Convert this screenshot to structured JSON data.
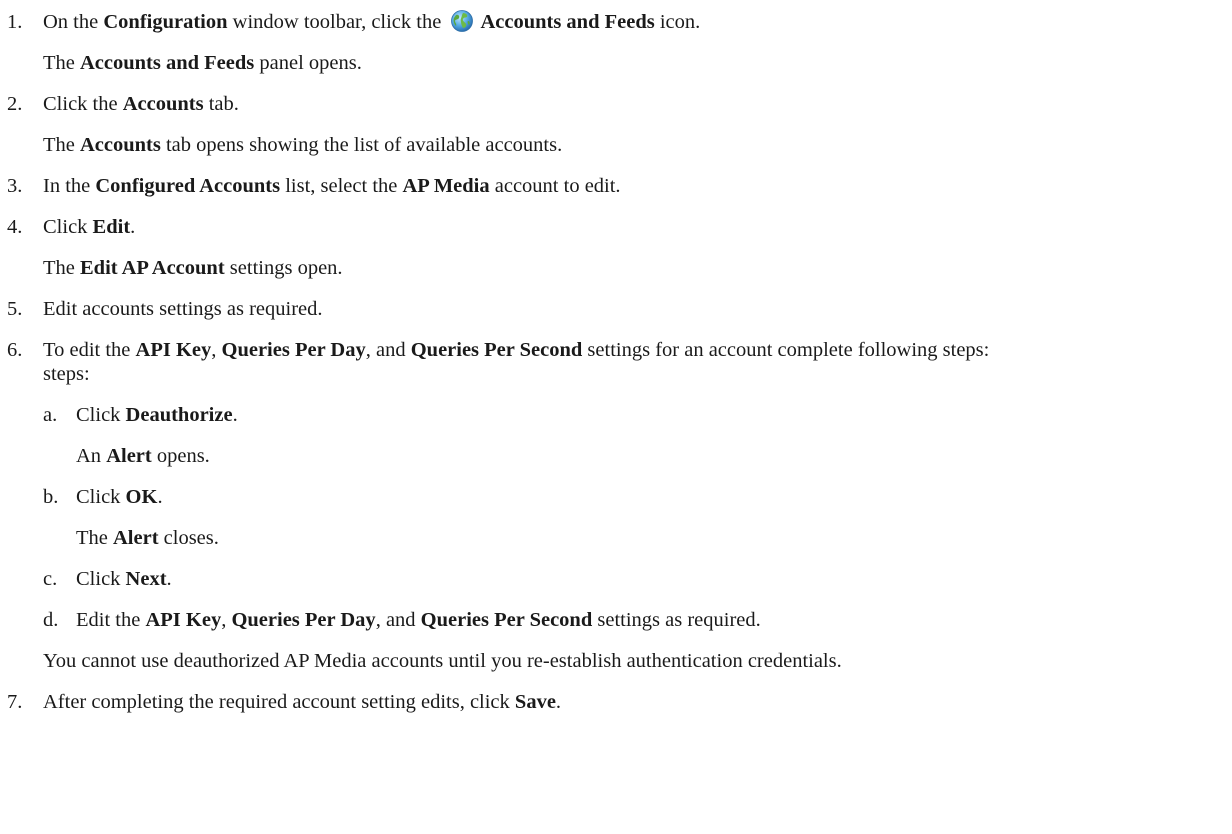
{
  "steps": [
    {
      "num": "1.",
      "parts": [
        {
          "t": "On the "
        },
        {
          "b": "Configuration"
        },
        {
          "t": " window toolbar, click the "
        },
        {
          "icon": "globe-icon"
        },
        {
          "b": "Accounts and Feeds"
        },
        {
          "t": " icon."
        }
      ],
      "result": [
        {
          "t": "The "
        },
        {
          "b": "Accounts and Feeds"
        },
        {
          "t": " panel opens."
        }
      ]
    },
    {
      "num": "2.",
      "parts": [
        {
          "t": "Click the "
        },
        {
          "b": "Accounts"
        },
        {
          "t": " tab."
        }
      ],
      "result": [
        {
          "t": "The "
        },
        {
          "b": "Accounts"
        },
        {
          "t": " tab opens showing the list of available accounts."
        }
      ]
    },
    {
      "num": "3.",
      "parts": [
        {
          "t": "In the "
        },
        {
          "b": "Configured Accounts"
        },
        {
          "t": " list, select the "
        },
        {
          "b": "AP Media"
        },
        {
          "t": " account to edit."
        }
      ]
    },
    {
      "num": "4.",
      "parts": [
        {
          "t": "Click "
        },
        {
          "b": "Edit"
        },
        {
          "t": "."
        }
      ],
      "result": [
        {
          "t": "The "
        },
        {
          "b": "Edit AP Account"
        },
        {
          "t": " settings open."
        }
      ]
    },
    {
      "num": "5.",
      "parts": [
        {
          "t": "Edit accounts settings as required."
        }
      ]
    },
    {
      "num": "6.",
      "parts": [
        {
          "t": "To edit the "
        },
        {
          "b": "API Key"
        },
        {
          "t": ", "
        },
        {
          "b": "Queries Per Day"
        },
        {
          "t": ", and "
        },
        {
          "b": "Queries Per Second"
        },
        {
          "t": " settings for an account complete following steps:"
        }
      ],
      "substeps": [
        {
          "letter": "a.",
          "parts": [
            {
              "t": "Click "
            },
            {
              "b": "Deauthorize"
            },
            {
              "t": "."
            }
          ],
          "result": [
            {
              "t": "An "
            },
            {
              "b": "Alert"
            },
            {
              "t": " opens."
            }
          ]
        },
        {
          "letter": "b.",
          "parts": [
            {
              "t": "Click "
            },
            {
              "b": "OK"
            },
            {
              "t": "."
            }
          ],
          "result": [
            {
              "t": "The "
            },
            {
              "b": "Alert"
            },
            {
              "t": " closes."
            }
          ]
        },
        {
          "letter": "c.",
          "parts": [
            {
              "t": "Click "
            },
            {
              "b": "Next"
            },
            {
              "t": "."
            }
          ]
        },
        {
          "letter": "d.",
          "parts": [
            {
              "t": "Edit the "
            },
            {
              "b": "API Key"
            },
            {
              "t": ", "
            },
            {
              "b": "Queries Per Day"
            },
            {
              "t": ", and "
            },
            {
              "b": "Queries Per Second"
            },
            {
              "t": " settings as required."
            }
          ]
        }
      ],
      "note": "You cannot use deauthorized AP Media accounts until you re-establish authentication credentials."
    },
    {
      "num": "7.",
      "parts": [
        {
          "t": "After completing the required account setting edits, click "
        },
        {
          "b": "Save"
        },
        {
          "t": "."
        }
      ]
    }
  ],
  "colors": {
    "text": "#1a1a1a",
    "background": "#ffffff"
  }
}
